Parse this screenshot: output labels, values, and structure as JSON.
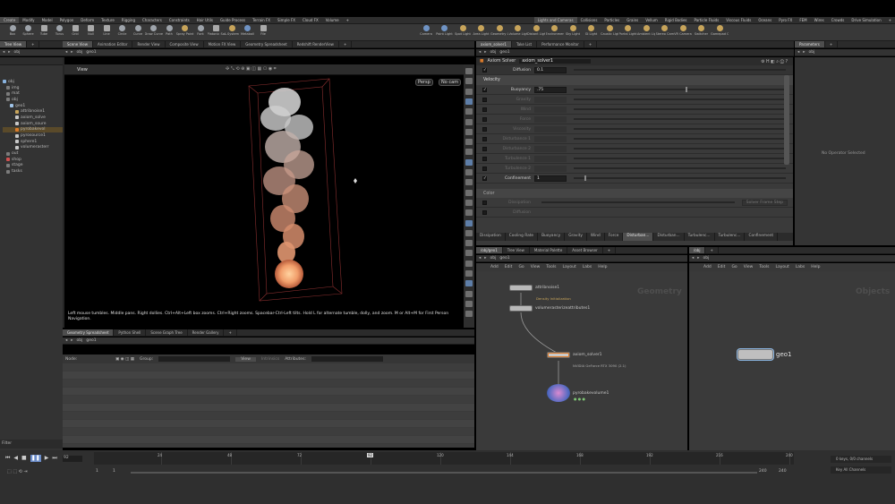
{
  "shelf_tabs": [
    "Create",
    "Modify",
    "Model",
    "Polygon",
    "Deform",
    "Texture",
    "Rigging",
    "Characters",
    "Constraints",
    "Hair Utils",
    "Guide Process",
    "Terrain FX",
    "Simple FX",
    "Cloud FX",
    "Volume",
    "+"
  ],
  "shelf_tabs_right": [
    "Lights and Cameras",
    "Collisions",
    "Particles",
    "Grains",
    "Vellum",
    "Rigid Bodies",
    "Particle Fluids",
    "Viscous Fluids",
    "Oceans",
    "Pyro FX",
    "FEM",
    "Wires",
    "Crowds",
    "Drive Simulation",
    "+"
  ],
  "tools_left": [
    "Box",
    "Sphere",
    "Tube",
    "Torus",
    "Grid",
    "Null",
    "Line",
    "Circle",
    "Curve",
    "Draw Curve",
    "Path",
    "Spray Paint",
    "Font",
    "Platonic Solids",
    "L-System",
    "Metaball",
    "File"
  ],
  "tools_right": [
    "Camera",
    "Point Light",
    "Spot Light",
    "Area Light",
    "Geometry Light",
    "Volume Light",
    "Distant Light",
    "Environment Light",
    "Sky Light",
    "GI Light",
    "Caustic Light",
    "Portal Light",
    "Ambient Light",
    "Stereo Camera",
    "VR Camera",
    "Switcher",
    "Gamepad Camera"
  ],
  "desk_tabs_left": [
    "Tree View",
    "+"
  ],
  "desk_tabs_center": [
    "Scene View",
    "Animation Editor",
    "Render View",
    "Composite View",
    "Motion FX View",
    "Geometry Spreadsheet",
    "Redshift RenderView",
    "+"
  ],
  "desk_tabs_params": [
    "axiom_solver1",
    "Take List",
    "Performance Monitor",
    "+"
  ],
  "desk_tabs_right": [
    "Parameters",
    "+"
  ],
  "path_obj": "obj",
  "path_geo": "geo1",
  "tree_items": [
    "obj",
    "img",
    "mat",
    "obj",
    "geo1",
    "attribnoise1",
    "axiom_solve",
    "axiom_soure",
    "pyrobakevol",
    "pyrosource1",
    "sphere1",
    "volumerasterr",
    "out",
    "shop",
    "stage",
    "tasks"
  ],
  "tree_filter": "Filter",
  "viewport": {
    "title": "View",
    "persp": "Persp",
    "cam": "No cam",
    "hint": "Left mouse tumbles. Middle pans. Right dollies. Ctrl+Alt+Left box zooms. Ctrl+Right zooms. Spacebar-Ctrl-Left tilts. Hold L for alternate tumble, dolly, and zoom.     M or Alt+M for First Person Navigation."
  },
  "params": {
    "node_type": "Axiom Solver",
    "node_name": "axiom_solver1",
    "diffusion_label": "Diffusion",
    "diffusion_value": "0.1",
    "velocity_header": "Velocity",
    "rows": [
      {
        "label": "Buoyancy",
        "value": ".75",
        "checked": true,
        "enabled": true
      },
      {
        "label": "Gravity",
        "value": "",
        "checked": false,
        "enabled": false
      },
      {
        "label": "Wind",
        "value": "",
        "checked": false,
        "enabled": false
      },
      {
        "label": "Force",
        "value": "",
        "checked": false,
        "enabled": false
      },
      {
        "label": "Viscosity",
        "value": "",
        "checked": false,
        "enabled": false
      },
      {
        "label": "Disturbance 1",
        "value": "",
        "checked": false,
        "enabled": false
      },
      {
        "label": "Disturbance 2",
        "value": "",
        "checked": false,
        "enabled": false
      },
      {
        "label": "Turbulence 1",
        "value": "",
        "checked": false,
        "enabled": false
      },
      {
        "label": "Turbulence 2",
        "value": "",
        "checked": false,
        "enabled": false
      },
      {
        "label": "Confinement",
        "value": "1",
        "checked": true,
        "enabled": true
      }
    ],
    "color_header": "Color",
    "dissipation_label": "Dissipation",
    "solver_frame_step": "Solver Frame Step",
    "diffusion2_label": "Diffusion",
    "bottom_tabs": [
      "Dissipation",
      "Cooling Rate",
      "Buoyancy",
      "Gravity",
      "Wind",
      "Force",
      "Disturban...",
      "Disturban...",
      "Turbulenc...",
      "Turbulenc...",
      "Confinement"
    ],
    "no_operator": "No Operator Selected"
  },
  "spreadsheet": {
    "tabs": [
      "Geometry Spreadsheet",
      "Python Shell",
      "Scene Graph Tree",
      "Render Gallery",
      "+"
    ],
    "node_label": "Node:",
    "group_label": "Group:",
    "view_label": "View",
    "intrinsics_label": "Intrinsics",
    "attributes_label": "Attributes:"
  },
  "network": {
    "tabs": [
      "/obj/geo1",
      "Tree View",
      "Material Palette",
      "Asset Browser",
      "+"
    ],
    "menu": [
      "Add",
      "Edit",
      "Go",
      "View",
      "Tools",
      "Layout",
      "Labs",
      "Help"
    ],
    "title": "Geometry",
    "nodes": [
      {
        "name": "attribnoise1",
        "sub": "Density Initialization"
      },
      {
        "name": "volumerasterizeattributes1",
        "sub": ""
      },
      {
        "name": "axiom_solver1",
        "sub": "NVIDIA GeForce RTX 3090 (2.1)"
      },
      {
        "name": "pyrobakevolume1",
        "sub": ""
      }
    ]
  },
  "objects": {
    "tabs": [
      "/obj",
      "+"
    ],
    "menu": [
      "Add",
      "Edit",
      "Go",
      "View",
      "Tools",
      "Layout",
      "Labs",
      "Help"
    ],
    "title": "Objects",
    "node": "geo1"
  },
  "timeline": {
    "frame": "92",
    "ticks": [
      "24",
      "48",
      "72",
      "92",
      "120",
      "144",
      "168",
      "192",
      "216",
      "240"
    ],
    "start": "1",
    "start2": "1",
    "end": "240",
    "end2": "240",
    "keys": "0 keys, 0/0 channels",
    "channels": "Key All Channels"
  }
}
